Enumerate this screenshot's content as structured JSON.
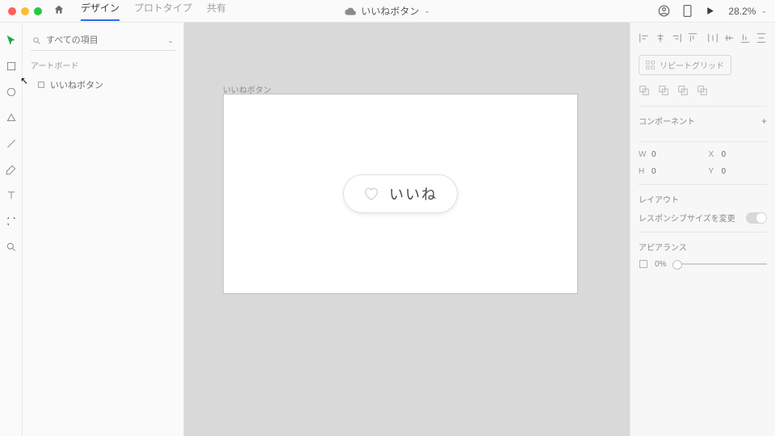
{
  "topbar": {
    "tabs": {
      "design": "デザイン",
      "prototype": "プロトタイプ",
      "share": "共有"
    },
    "docTitle": "いいねボタン",
    "zoom": "28.2%"
  },
  "layers": {
    "searchPlaceholder": "すべての項目",
    "section": "アートボード",
    "item1": "いいねボタン"
  },
  "canvas": {
    "artboardLabel": "いいねボタン",
    "likeText": "いいね"
  },
  "inspector": {
    "repeatGrid": "リピートグリッド",
    "componentSection": "コンポーネント",
    "w": {
      "label": "W",
      "value": "0"
    },
    "h": {
      "label": "H",
      "value": "0"
    },
    "x": {
      "label": "X",
      "value": "0"
    },
    "y": {
      "label": "Y",
      "value": "0"
    },
    "layoutSection": "レイアウト",
    "responsiveLabel": "レスポンシブサイズを変更",
    "appearanceSection": "アピアランス",
    "opacity": "0%"
  }
}
